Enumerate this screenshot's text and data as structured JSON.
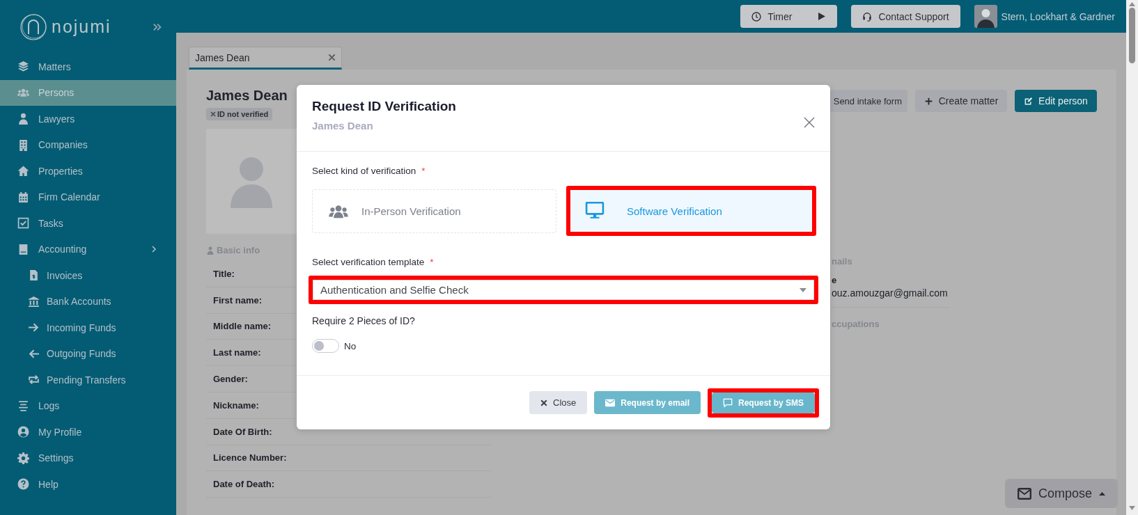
{
  "sidebar": {
    "logo": "nojumi",
    "items": [
      {
        "label": "Matters",
        "selected": false
      },
      {
        "label": "Persons",
        "selected": true
      },
      {
        "label": "Lawyers",
        "selected": false
      },
      {
        "label": "Companies",
        "selected": false
      },
      {
        "label": "Properties",
        "selected": false
      },
      {
        "label": "Firm Calendar",
        "selected": false
      },
      {
        "label": "Tasks",
        "selected": false
      },
      {
        "label": "Accounting",
        "selected": false,
        "children": [
          {
            "label": "Invoices",
            "selected": false
          },
          {
            "label": "Bank Accounts",
            "selected": false
          },
          {
            "label": "Incoming Funds",
            "selected": false
          },
          {
            "label": "Outgoing Funds",
            "selected": false
          },
          {
            "label": "Pending Transfers",
            "selected": false
          }
        ]
      },
      {
        "label": "Logs",
        "selected": false
      },
      {
        "label": "My Profile",
        "selected": false
      },
      {
        "label": "Settings",
        "selected": false
      },
      {
        "label": "Help",
        "selected": false
      }
    ]
  },
  "topbar": {
    "timer": "Timer",
    "support": "Contact Support",
    "account": "Stern, Lockhart & Gardner"
  },
  "tabs": [
    {
      "label": "James Dean",
      "selected": true
    }
  ],
  "person": {
    "name": "James Dean",
    "status_badge": "ID not verified",
    "actions": [
      {
        "label": "Send intake form",
        "kind": "intake"
      },
      {
        "label": "Create matter",
        "kind": "create"
      },
      {
        "label": "Edit person",
        "kind": "edit"
      }
    ],
    "basic_info": {
      "heading": "Basic info",
      "fields": [
        "Title:",
        "First name:",
        "Middle name:",
        "Last name:",
        "Gender:",
        "Nickname:",
        "Date Of Birth:",
        "Licence Number:",
        "Date of Death:"
      ]
    },
    "emails": {
      "heading": "nails",
      "label": "e",
      "value": "ouz.amouzgar@gmail.com"
    },
    "occupations": {
      "heading": "ccupations"
    }
  },
  "modal": {
    "title": "Request ID Verification",
    "subtitle": "James Dean",
    "kind_label": {
      "text": "Select kind of verification",
      "required_mark": "*"
    },
    "kinds": [
      {
        "label": "In-Person Verification",
        "kind": "in_person",
        "selected": false,
        "highlighted": false
      },
      {
        "label": "Software Verification",
        "kind": "software",
        "selected": true,
        "highlighted": true
      }
    ],
    "template_label": {
      "text": "Select verification template",
      "required_mark": "*"
    },
    "template": {
      "value": "Authentication and Selfie Check",
      "highlighted": true
    },
    "require_label": "Require 2 Pieces of ID?",
    "require_toggle": {
      "on": false,
      "label": "No"
    },
    "buttons": [
      {
        "label": "Close",
        "kind": "close",
        "highlighted": false
      },
      {
        "label": "Request by email",
        "kind": "email",
        "highlighted": false
      },
      {
        "label": "Request by SMS",
        "kind": "sms",
        "highlighted": true
      }
    ]
  },
  "compose": {
    "label": "Compose"
  }
}
